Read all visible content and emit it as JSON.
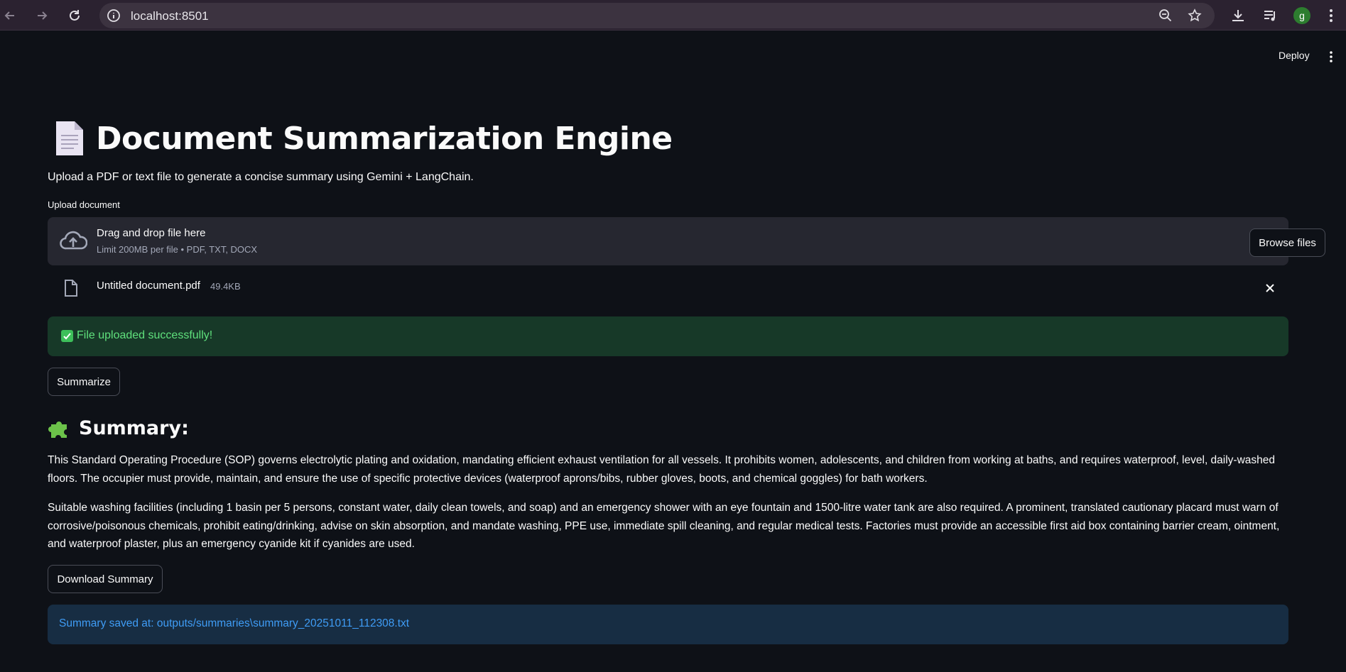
{
  "browser": {
    "url": "localhost:8501",
    "profile_initial": "g"
  },
  "header": {
    "deploy_label": "Deploy"
  },
  "page": {
    "title": "Document Summarization Engine",
    "subtitle": "Upload a PDF or text file to generate a concise summary using Gemini + LangChain."
  },
  "uploader": {
    "label": "Upload document",
    "drop_title": "Drag and drop file here",
    "drop_limit": "Limit 200MB per file • PDF, TXT, DOCX",
    "browse_label": "Browse files"
  },
  "file": {
    "name": "Untitled document.pdf",
    "size": "49.4KB"
  },
  "success": {
    "message": "File uploaded successfully!"
  },
  "actions": {
    "summarize_label": "Summarize",
    "download_label": "Download Summary"
  },
  "summary": {
    "heading": "Summary:",
    "paragraphs": [
      "This Standard Operating Procedure (SOP) governs electrolytic plating and oxidation, mandating efficient exhaust ventilation for all vessels. It prohibits women, adolescents, and children from working at baths, and requires waterproof, level, daily-washed floors. The occupier must provide, maintain, and ensure the use of specific protective devices (waterproof aprons/bibs, rubber gloves, boots, and chemical goggles) for bath workers.",
      "Suitable washing facilities (including 1 basin per 5 persons, constant water, daily clean towels, and soap) and an emergency shower with an eye fountain and 1500-litre water tank are also required. A prominent, translated cautionary placard must warn of corrosive/poisonous chemicals, prohibit eating/drinking, advise on skin absorption, and mandate washing, PPE use, immediate spill cleaning, and regular medical tests. Factories must provide an accessible first aid box containing barrier cream, ointment, and waterproof plaster, plus an emergency cyanide kit if cyanides are used."
    ]
  },
  "info": {
    "message": "Summary saved at: outputs/summaries\\summary_20251011_112308.txt"
  },
  "colors": {
    "background": "#0e1117",
    "success_bg": "#173928",
    "success_text": "#5fe07c",
    "info_bg": "#172d43",
    "info_text": "#3f9cf5"
  }
}
